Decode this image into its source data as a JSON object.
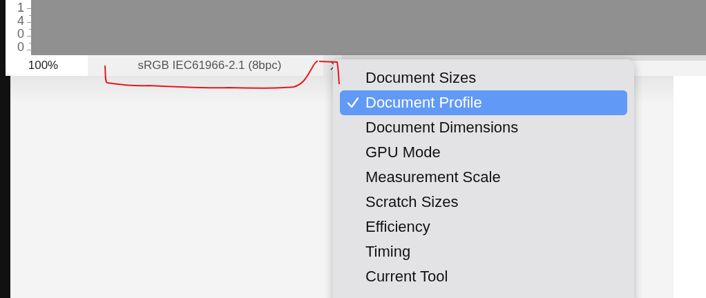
{
  "ruler": {
    "digits": [
      "1",
      "4",
      "0",
      "0"
    ]
  },
  "status_bar": {
    "zoom": "100%",
    "profile": "sRGB IEC61966-2.1 (8bpc)"
  },
  "menu": {
    "items": [
      {
        "label": "Document Sizes",
        "selected": false
      },
      {
        "label": "Document Profile",
        "selected": true
      },
      {
        "label": "Document Dimensions",
        "selected": false
      },
      {
        "label": "GPU Mode",
        "selected": false
      },
      {
        "label": "Measurement Scale",
        "selected": false
      },
      {
        "label": "Scratch Sizes",
        "selected": false
      },
      {
        "label": "Efficiency",
        "selected": false
      },
      {
        "label": "Timing",
        "selected": false
      },
      {
        "label": "Current Tool",
        "selected": false
      }
    ]
  }
}
